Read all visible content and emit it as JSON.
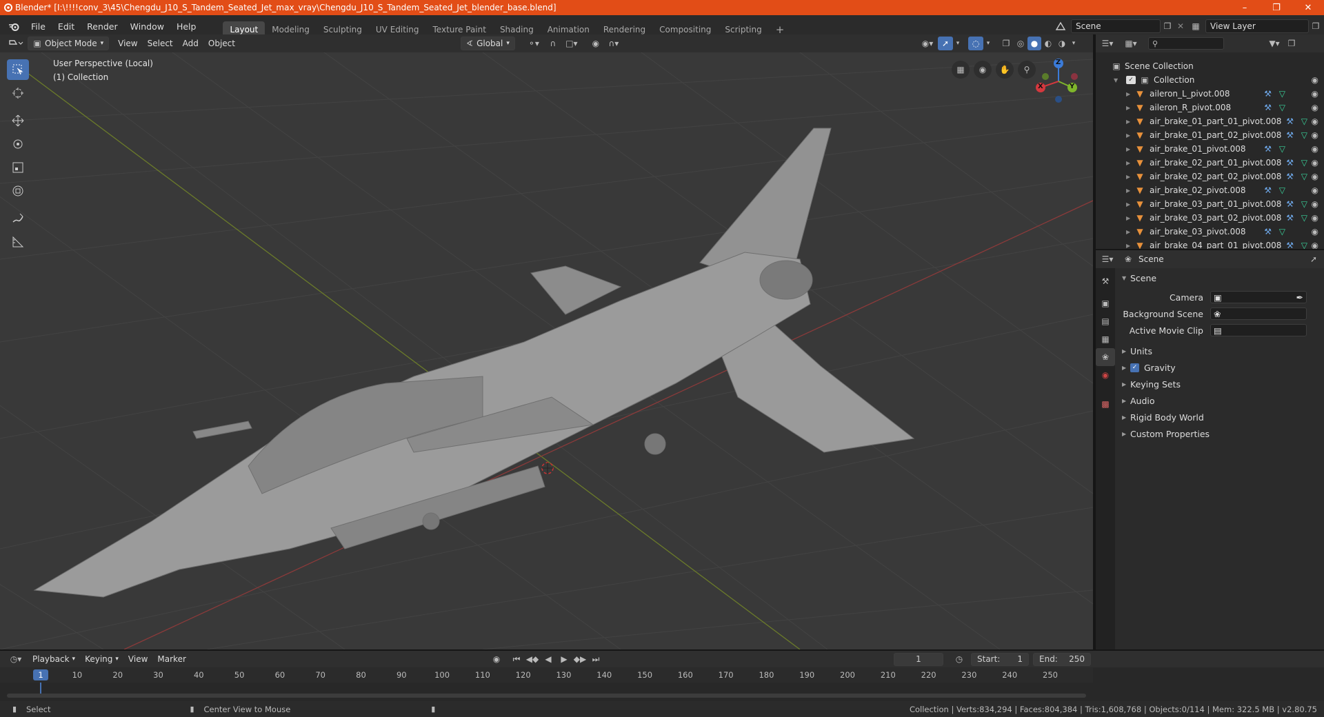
{
  "titlebar": {
    "text": "Blender* [I:\\!!!!conv_3\\45\\Chengdu_J10_S_Tandem_Seated_Jet_max_vray\\Chengdu_J10_S_Tandem_Seated_Jet_blender_base.blend]",
    "accent": "#e24d17"
  },
  "menu": [
    "File",
    "Edit",
    "Render",
    "Window",
    "Help"
  ],
  "workspaces": [
    "Layout",
    "Modeling",
    "Sculpting",
    "UV Editing",
    "Texture Paint",
    "Shading",
    "Animation",
    "Rendering",
    "Compositing",
    "Scripting"
  ],
  "active_workspace": "Layout",
  "scene_field": "Scene",
  "viewlayer_field": "View Layer",
  "viewport": {
    "mode": "Object Mode",
    "menus": [
      "View",
      "Select",
      "Add",
      "Object"
    ],
    "orientation": "Global",
    "overlay_title": "User Perspective (Local)",
    "overlay_sub": "(1) Collection",
    "gizmo": {
      "z": "Z",
      "y": "Y",
      "x": "X"
    }
  },
  "outliner": {
    "root": "Scene Collection",
    "collection": "Collection",
    "items": [
      "aileron_L_pivot.008",
      "aileron_R_pivot.008",
      "air_brake_01_part_01_pivot.008",
      "air_brake_01_part_02_pivot.008",
      "air_brake_01_pivot.008",
      "air_brake_02_part_01_pivot.008",
      "air_brake_02_part_02_pivot.008",
      "air_brake_02_pivot.008",
      "air_brake_03_part_01_pivot.008",
      "air_brake_03_part_02_pivot.008",
      "air_brake_03_pivot.008",
      "air_brake_04_part_01_pivot.008"
    ]
  },
  "properties": {
    "context": "Scene",
    "panel": "Scene",
    "fields": [
      {
        "label": "Camera"
      },
      {
        "label": "Background Scene"
      },
      {
        "label": "Active Movie Clip"
      }
    ],
    "sections": [
      "Units",
      "Gravity",
      "Keying Sets",
      "Audio",
      "Rigid Body World",
      "Custom Properties"
    ],
    "gravity_checked": true
  },
  "timeline": {
    "menus": [
      "Playback",
      "Keying",
      "View",
      "Marker"
    ],
    "current_frame": "1",
    "start_label": "Start:",
    "start": "1",
    "end_label": "End:",
    "end": "250",
    "ticks": [
      "1",
      "10",
      "20",
      "30",
      "40",
      "50",
      "60",
      "70",
      "80",
      "90",
      "100",
      "110",
      "120",
      "130",
      "140",
      "150",
      "160",
      "170",
      "180",
      "190",
      "200",
      "210",
      "220",
      "230",
      "240",
      "250"
    ]
  },
  "statusbar": {
    "left": "Select",
    "middle": "Center View to Mouse",
    "right": "Collection | Verts:834,294 | Faces:804,384 | Tris:1,608,768 | Objects:0/114 | Mem: 322.5 MB | v2.80.75"
  }
}
